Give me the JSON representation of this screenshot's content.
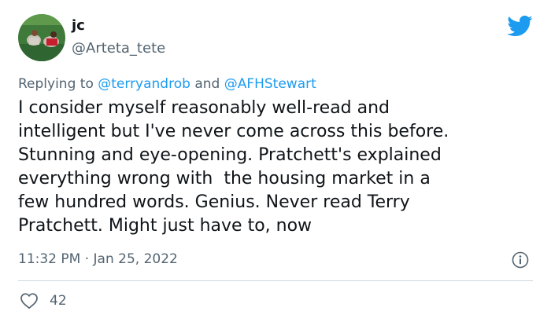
{
  "author": {
    "name": "jc",
    "handle": "@Arteta_tete",
    "avatar": "avatar-photo"
  },
  "reply": {
    "prefix": "Replying to",
    "mention1": "@terryandrob",
    "conjunction": "and",
    "mention2": "@AFHStewart"
  },
  "body": {
    "lines": [
      "I consider myself reasonably well-read and",
      "intelligent but I've never come across this before.",
      "Stunning and eye-opening. Pratchett's explained",
      "everything wrong with  the housing market in a",
      "few hundred words. Genius. Never read Terry",
      "Pratchett. Might just have to, now"
    ]
  },
  "meta": {
    "time": "11:32 PM",
    "separator": "·",
    "date": "Jan 25, 2022"
  },
  "stats": {
    "likes": "42"
  },
  "icons": {
    "brand": "twitter-bird-icon",
    "info": "info-icon",
    "like": "heart-icon"
  },
  "colors": {
    "brand": "#1d9bf0",
    "text": "#0f1419",
    "secondary": "#536471",
    "divider": "#cfd9de"
  }
}
